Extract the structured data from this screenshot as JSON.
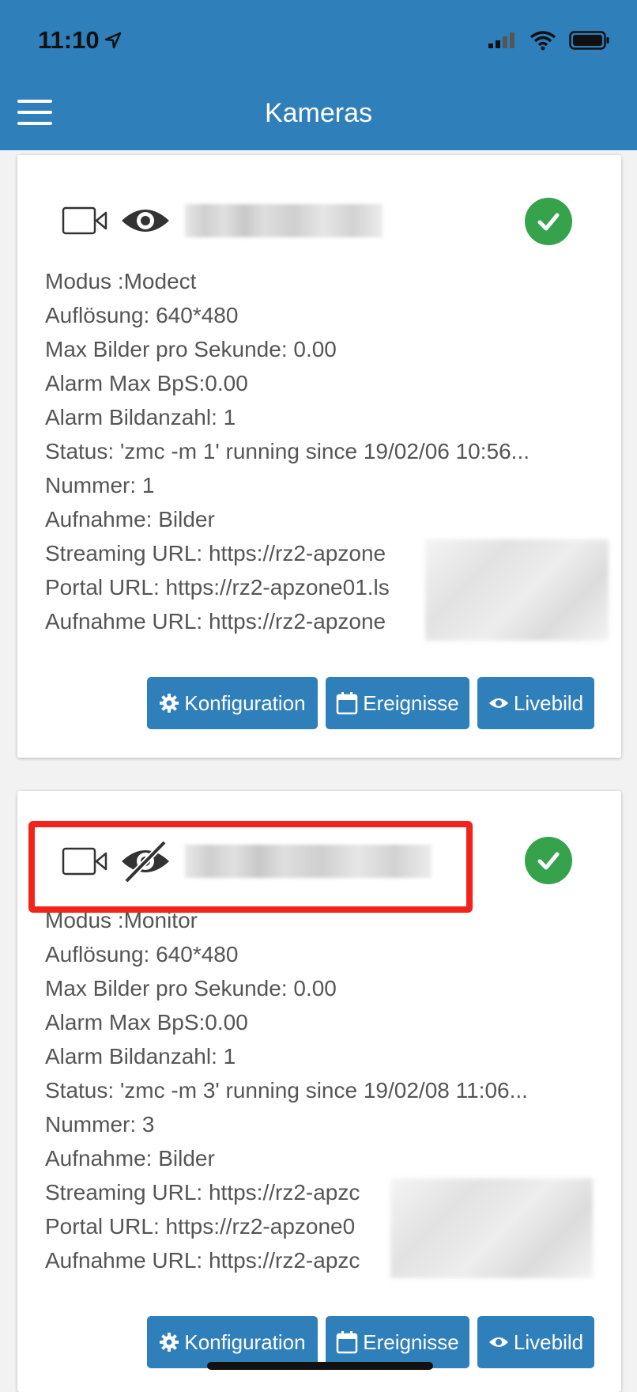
{
  "status_bar": {
    "time": "11:10"
  },
  "nav": {
    "title": "Kameras"
  },
  "cameras": [
    {
      "details": [
        "Modus :Modect",
        "Auflösung: 640*480",
        "Max Bilder pro Sekunde: 0.00",
        "Alarm Max BpS:0.00",
        "Alarm Bildanzahl: 1",
        "Status: 'zmc -m 1' running since 19/02/06 10:56...",
        "Nummer: 1",
        "Aufnahme: Bilder",
        "Streaming URL: https://rz2-apzone",
        "Portal URL: https://rz2-apzone01.ls",
        "Aufnahme URL: https://rz2-apzone"
      ],
      "buttons": {
        "config": "Konfiguration",
        "events": "Ereignisse",
        "live": "Livebild"
      }
    },
    {
      "details": [
        "Modus :Monitor",
        "Auflösung: 640*480",
        "Max Bilder pro Sekunde: 0.00",
        "Alarm Max BpS:0.00",
        "Alarm Bildanzahl: 1",
        "Status: 'zmc -m 3' running since 19/02/08 11:06...",
        "Nummer: 3",
        "Aufnahme: Bilder",
        "Streaming URL: https://rz2-apzc",
        "Portal URL: https://rz2-apzone0",
        "Aufnahme URL: https://rz2-apzc"
      ],
      "buttons": {
        "config": "Konfiguration",
        "events": "Ereignisse",
        "live": "Livebild"
      }
    }
  ],
  "icons": {
    "camera": "video-camera-icon",
    "visible": "eye-icon",
    "hidden": "eye-slash-icon",
    "ok": "check-circle-icon",
    "config": "gear-icon",
    "events": "calendar-icon",
    "live": "eye-icon"
  },
  "colors": {
    "primary": "#2f7fbb",
    "success": "#36a24c",
    "highlight": "#f2231a"
  }
}
